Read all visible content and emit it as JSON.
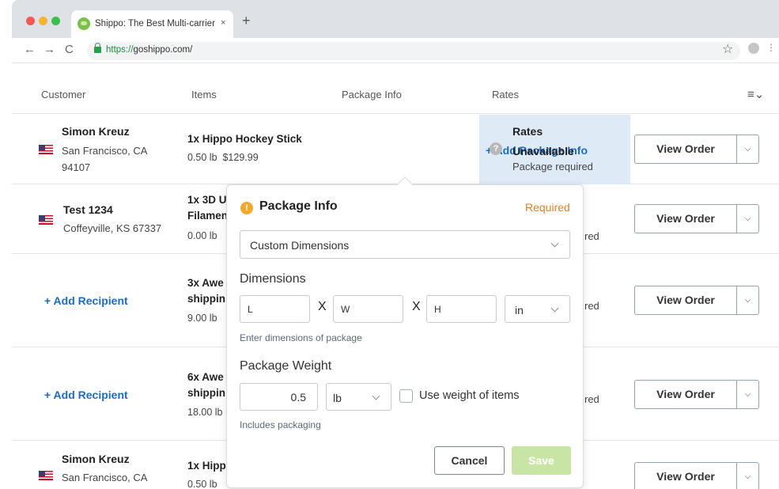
{
  "browser": {
    "tab_title": "Shippo: The Best Multi-carrier",
    "tab_close": "×",
    "new_tab": "+",
    "url_secure": "https://",
    "url_rest": "goshippo.com/",
    "back": "←",
    "forward": "→",
    "reload": "C",
    "star": "☆",
    "more": "⋮"
  },
  "table": {
    "headers": [
      "Customer",
      "Items",
      "Package Info",
      "Rates"
    ],
    "menu_icon": "≡⌄"
  },
  "rows": [
    {
      "customer_name": "Simon Kreuz",
      "customer_addr": "San Francisco, CA 94107",
      "item_name": "1x Hippo Hockey Stick",
      "item_meta": "0.50 lb  $129.99",
      "package_link": "+ Add Package Info",
      "rates_title": "Rates",
      "rates_unavailable": "Unavailable",
      "rates_sub": "Package required",
      "view_order": "View Order"
    },
    {
      "customer_name": "Test 1234",
      "customer_addr": "Coffeyville, KS 67337",
      "item_name": "1x 3D U\nFilamen",
      "item_meta": "0.00 lb",
      "rates_frag": "red",
      "view_order": "View Order"
    },
    {
      "add_recipient": "+ Add Recipient",
      "item_name": "3x Awe\nshippin",
      "item_meta": "9.00 lb",
      "rates_frag": "red",
      "view_order": "View Order"
    },
    {
      "add_recipient": "+ Add Recipient",
      "item_name": "6x Awe\nshippin",
      "item_meta": "18.00 lb",
      "rates_frag": "red",
      "view_order": "View Order"
    },
    {
      "customer_name": "Simon Kreuz",
      "customer_addr": "San Francisco, CA",
      "item_name": "1x Hipp",
      "item_meta": "0.50 lb",
      "view_order": "View Order"
    }
  ],
  "popover": {
    "title": "Package Info",
    "required": "Required",
    "warn_glyph": "!",
    "template_select": "Custom Dimensions",
    "dimensions_label": "Dimensions",
    "length_placeholder": "L",
    "width_placeholder": "W",
    "height_placeholder": "H",
    "times": "X",
    "unit": "in",
    "dimensions_hint": "Enter dimensions of package",
    "weight_label": "Package Weight",
    "weight_value": "0.5",
    "weight_unit": "lb",
    "use_weight_label": "Use weight of items",
    "weight_hint": "Includes packaging",
    "cancel": "Cancel",
    "save": "Save"
  }
}
